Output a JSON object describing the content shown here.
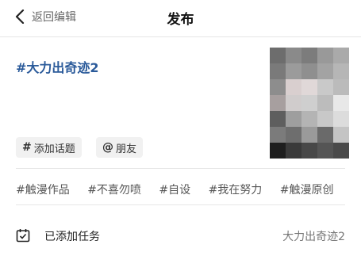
{
  "header": {
    "back_label": "返回编辑",
    "title": "发布"
  },
  "post": {
    "text": "#大力出奇迹2"
  },
  "chips": [
    {
      "symbol": "#",
      "label": "添加话题"
    },
    {
      "symbol": "@",
      "label": "朋友"
    }
  ],
  "suggested_tags": [
    "#触漫作品",
    "#不喜勿喷",
    "#自设",
    "#我在努力",
    "#触漫原创"
  ],
  "task": {
    "label": "已添加任务",
    "value": "大力出奇迹2"
  },
  "colors": {
    "hashtag": "#2a5a9a",
    "chip_bg": "#f1f1f1"
  },
  "icons": {
    "back": "chevron-left-icon",
    "task": "calendar-check-icon"
  }
}
